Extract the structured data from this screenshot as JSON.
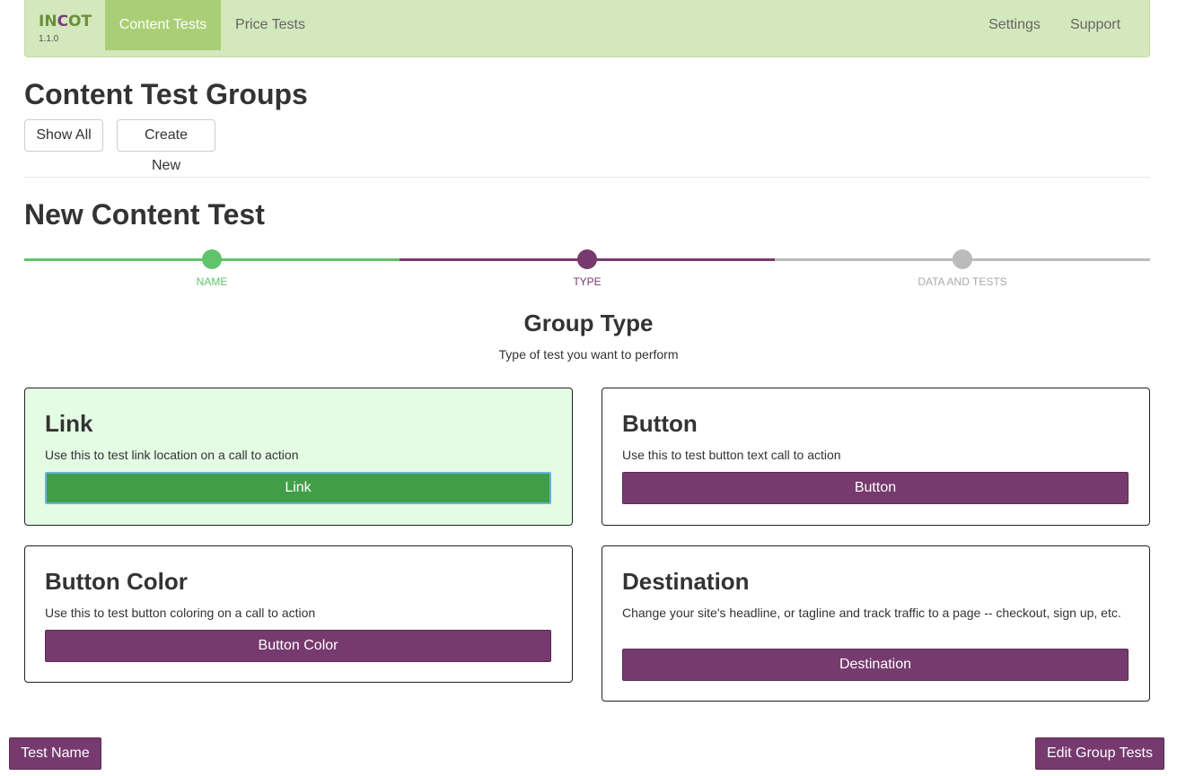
{
  "navbar": {
    "brand": {
      "logo_part1": "IN",
      "logo_accent": "C",
      "logo_part2": "OT",
      "version": "1.1.0"
    },
    "items": [
      {
        "label": "Content Tests",
        "active": true
      },
      {
        "label": "Price Tests",
        "active": false
      }
    ],
    "right_items": [
      {
        "label": "Settings"
      },
      {
        "label": "Support"
      }
    ]
  },
  "groups": {
    "title": "Content Test Groups",
    "show_all_label": "Show All",
    "create_new_label": "Create New"
  },
  "new_test": {
    "title": "New Content Test",
    "steps": [
      {
        "label": "NAME",
        "status": "complete"
      },
      {
        "label": "TYPE",
        "status": "current"
      },
      {
        "label": "DATA AND TESTS",
        "status": "pending"
      }
    ]
  },
  "group_type": {
    "title": "Group Type",
    "subtitle": "Type of test you want to perform",
    "cards": [
      {
        "title": "Link",
        "description": "Use this to test link location on a call to action",
        "button_label": "Link",
        "selected": true
      },
      {
        "title": "Button",
        "description": "Use this to test button text call to action",
        "button_label": "Button",
        "selected": false
      },
      {
        "title": "Button Color",
        "description": "Use this to test button coloring on a call to action",
        "button_label": "Button Color",
        "selected": false
      },
      {
        "title": "Destination",
        "description": "Change your site's headline, or tagline and track traffic to a page -- checkout, sign up, etc.",
        "button_label": "Destination",
        "selected": false
      }
    ]
  },
  "footer": {
    "prev_label": "Test Name",
    "next_label": "Edit Group Tests"
  },
  "colors": {
    "navbar_bg": "#d3e8bc",
    "nav_active": "#a9cf76",
    "step_complete": "#5fc46b",
    "step_current": "#763a6e",
    "step_pending": "#bbbbbb",
    "primary_button": "#763a6e",
    "selected_button": "#419d48",
    "selected_card_bg": "#e4fbe4"
  }
}
